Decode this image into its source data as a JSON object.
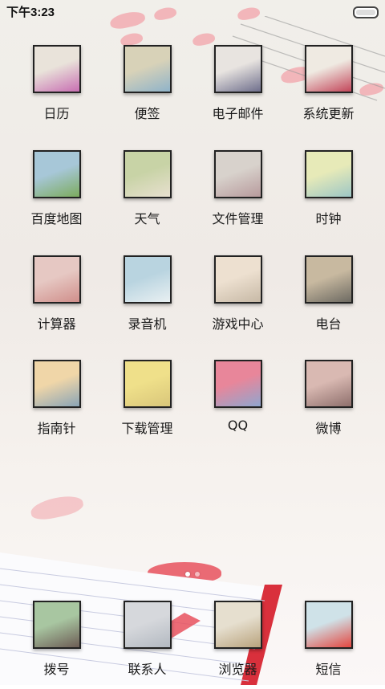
{
  "status": {
    "time": "下午3:23"
  },
  "apps": [
    {
      "label": "日历",
      "name": "app-calendar",
      "colors": [
        "#e9e3da",
        "#c86fb2"
      ]
    },
    {
      "label": "便签",
      "name": "app-notes",
      "colors": [
        "#d8d2b8",
        "#8fb3c9"
      ]
    },
    {
      "label": "电子邮件",
      "name": "app-email",
      "colors": [
        "#e8e4e0",
        "#6f6f8c"
      ]
    },
    {
      "label": "系统更新",
      "name": "app-system-update",
      "colors": [
        "#efeae2",
        "#c3465a"
      ]
    },
    {
      "label": "百度地图",
      "name": "app-baidu-map",
      "colors": [
        "#a7c7d8",
        "#7cab5e"
      ]
    },
    {
      "label": "天气",
      "name": "app-weather",
      "colors": [
        "#c8d3a6",
        "#e8e0cf"
      ]
    },
    {
      "label": "文件管理",
      "name": "app-file-manager",
      "colors": [
        "#d8d2cc",
        "#b79a9c"
      ]
    },
    {
      "label": "时钟",
      "name": "app-clock",
      "colors": [
        "#e7eab8",
        "#9cc6c5"
      ]
    },
    {
      "label": "计算器",
      "name": "app-calculator",
      "colors": [
        "#e6c8c3",
        "#d08f8b"
      ]
    },
    {
      "label": "录音机",
      "name": "app-recorder",
      "colors": [
        "#b9d4e0",
        "#e9f0f2"
      ]
    },
    {
      "label": "游戏中心",
      "name": "app-game-center",
      "colors": [
        "#ede0d0",
        "#c7b9a6"
      ]
    },
    {
      "label": "电台",
      "name": "app-radio",
      "colors": [
        "#c8b9a0",
        "#6d6a62"
      ]
    },
    {
      "label": "指南针",
      "name": "app-compass",
      "colors": [
        "#f0d6a8",
        "#8aa4b6"
      ]
    },
    {
      "label": "下载管理",
      "name": "app-download-manager",
      "colors": [
        "#efe08a",
        "#d9c67a"
      ]
    },
    {
      "label": "QQ",
      "name": "app-qq",
      "colors": [
        "#e8869a",
        "#8fa6cf"
      ]
    },
    {
      "label": "微博",
      "name": "app-weibo",
      "colors": [
        "#d9b9b2",
        "#8e6f6c"
      ]
    }
  ],
  "dock": [
    {
      "label": "拨号",
      "name": "dock-dialer",
      "colors": [
        "#a8c6a1",
        "#6d5d55"
      ]
    },
    {
      "label": "联系人",
      "name": "dock-contacts",
      "colors": [
        "#d6d8dc",
        "#b3b9c1"
      ]
    },
    {
      "label": "浏览器",
      "name": "dock-browser",
      "colors": [
        "#e6dfcf",
        "#b9a37d"
      ]
    },
    {
      "label": "短信",
      "name": "dock-sms",
      "colors": [
        "#cfe2e8",
        "#e3463f"
      ]
    }
  ],
  "pager": {
    "page_count": 2,
    "current_page": 1
  }
}
